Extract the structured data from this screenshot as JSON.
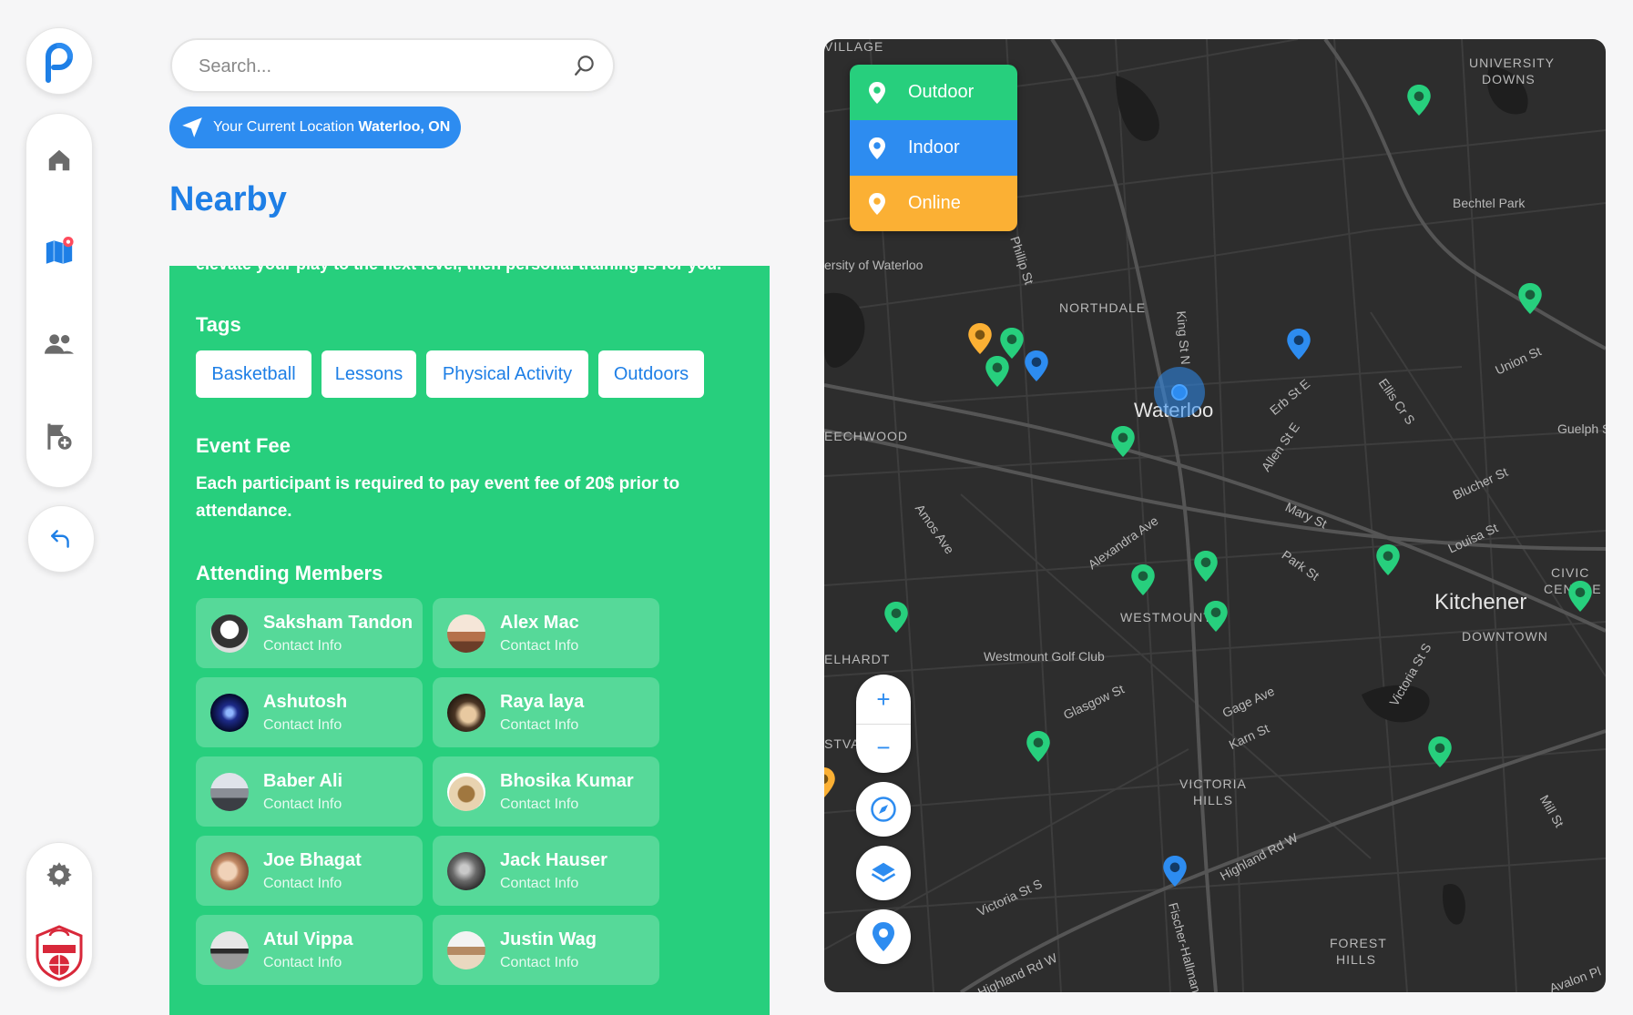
{
  "sidebar": {
    "logo": "app-logo",
    "nav": [
      "home-icon",
      "map-icon",
      "users-icon",
      "add-flag-icon"
    ],
    "back": "back-arrow-icon",
    "settings": "gear-icon",
    "badge_text": "BASKETBALL ACADEMY"
  },
  "search": {
    "placeholder": "Search..."
  },
  "location": {
    "prefix": "Your Current Location ",
    "city": "Waterloo, ON"
  },
  "page_title": "Nearby",
  "event": {
    "description_fragment": "elevate your play to the next level, then personal training is for you.",
    "tags_heading": "Tags",
    "tags": [
      "Basketball",
      "Lessons",
      "Physical Activity",
      "Outdoors"
    ],
    "fee_heading": "Event Fee",
    "fee_text": "Each participant is required to pay event fee of 20$ prior to attendance.",
    "members_heading": "Attending Members",
    "members": [
      {
        "name": "Saksham Tandon",
        "info": "Contact Info"
      },
      {
        "name": "Alex Mac",
        "info": "Contact Info"
      },
      {
        "name": "Ashutosh",
        "info": "Contact Info"
      },
      {
        "name": "Raya laya",
        "info": "Contact Info"
      },
      {
        "name": "Baber Ali",
        "info": "Contact Info"
      },
      {
        "name": "Bhosika Kumar",
        "info": "Contact Info"
      },
      {
        "name": "Joe Bhagat",
        "info": "Contact Info"
      },
      {
        "name": "Jack Hauser",
        "info": "Contact Info"
      },
      {
        "name": "Atul Vippa",
        "info": "Contact Info"
      },
      {
        "name": "Justin Wag",
        "info": "Contact Info"
      }
    ]
  },
  "map": {
    "legend": [
      {
        "label": "Outdoor",
        "color": "#27cf7d"
      },
      {
        "label": "Indoor",
        "color": "#2d8cf0"
      },
      {
        "label": "Online",
        "color": "#fbb034"
      }
    ],
    "controls": {
      "zoom_in": "+",
      "zoom_out": "−",
      "compass": "compass-icon",
      "layers": "layers-icon",
      "locate": "location-pin-icon"
    },
    "labels": [
      "VILLAGE",
      "UNIVERSITY",
      "DOWNS",
      "Bechtel Park",
      "ersity of Waterloo",
      "Phillip St",
      "NORTHDALE",
      "King St N",
      "Waterloo",
      "Erb St E",
      "Ellis Cr S",
      "Union St",
      "EECHWOOD",
      "Allen St E",
      "Guelph S",
      "Blucher St",
      "Mary St",
      "Amos Ave",
      "Alexandra Ave",
      "Park St",
      "Louisa St",
      "CIVIC",
      "CENTRE",
      "Kitchener",
      "WESTMOUNT",
      "DOWNTOWN",
      "ELHARDT",
      "Westmount Golf Club",
      "Victoria St S",
      "Glasgow St",
      "Gage Ave",
      "STVA",
      "Karn St",
      "VICTORIA",
      "HILLS",
      "Mill St",
      "Highland Rd W",
      "Fischer-Hallman",
      "FOREST",
      "HILLS",
      "Avalon Pl"
    ]
  }
}
